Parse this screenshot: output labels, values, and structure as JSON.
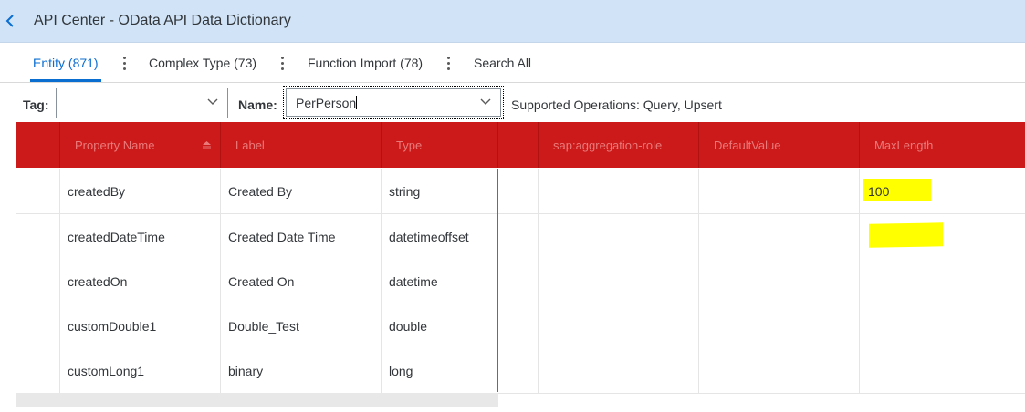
{
  "header": {
    "title": "API Center - OData API Data Dictionary"
  },
  "tabs": [
    {
      "label": "Entity (871)",
      "active": true
    },
    {
      "label": "Complex Type (73)",
      "active": false
    },
    {
      "label": "Function Import (78)",
      "active": false
    },
    {
      "label": "Search All",
      "active": false
    }
  ],
  "filters": {
    "tag_label": "Tag:",
    "tag_value": "",
    "name_label": "Name:",
    "name_value": "PerPerson",
    "supported_operations": "Supported Operations: Query, Upsert"
  },
  "table": {
    "columns": [
      "Property Name",
      "Label",
      "Type",
      "sap:aggregation-role",
      "DefaultValue",
      "MaxLength"
    ],
    "rows": [
      {
        "property": "createdBy",
        "label": "Created By",
        "type": "string",
        "aggregation_role": "",
        "default_value": "",
        "max_length": "100"
      },
      {
        "property": "createdDateTime",
        "label": "Created Date Time",
        "type": "datetimeoffset",
        "aggregation_role": "",
        "default_value": "",
        "max_length": ""
      },
      {
        "property": "createdOn",
        "label": "Created On",
        "type": "datetime",
        "aggregation_role": "",
        "default_value": "",
        "max_length": ""
      },
      {
        "property": "customDouble1",
        "label": "Double_Test",
        "type": "double",
        "aggregation_role": "",
        "default_value": "",
        "max_length": ""
      },
      {
        "property": "customLong1",
        "label": "binary",
        "type": "long",
        "aggregation_role": "",
        "default_value": "",
        "max_length": ""
      }
    ]
  },
  "colors": {
    "shell_bg": "#d1e4f7",
    "accent": "#0a6ed1",
    "table_header_bg": "#cc1919",
    "highlight": "#ffff00"
  },
  "icons": {
    "back": "chevron-left-icon",
    "dropdown": "chevron-down-icon",
    "sort": "sort-ascending-icon",
    "overflow": "vertical-ellipsis-icon"
  }
}
